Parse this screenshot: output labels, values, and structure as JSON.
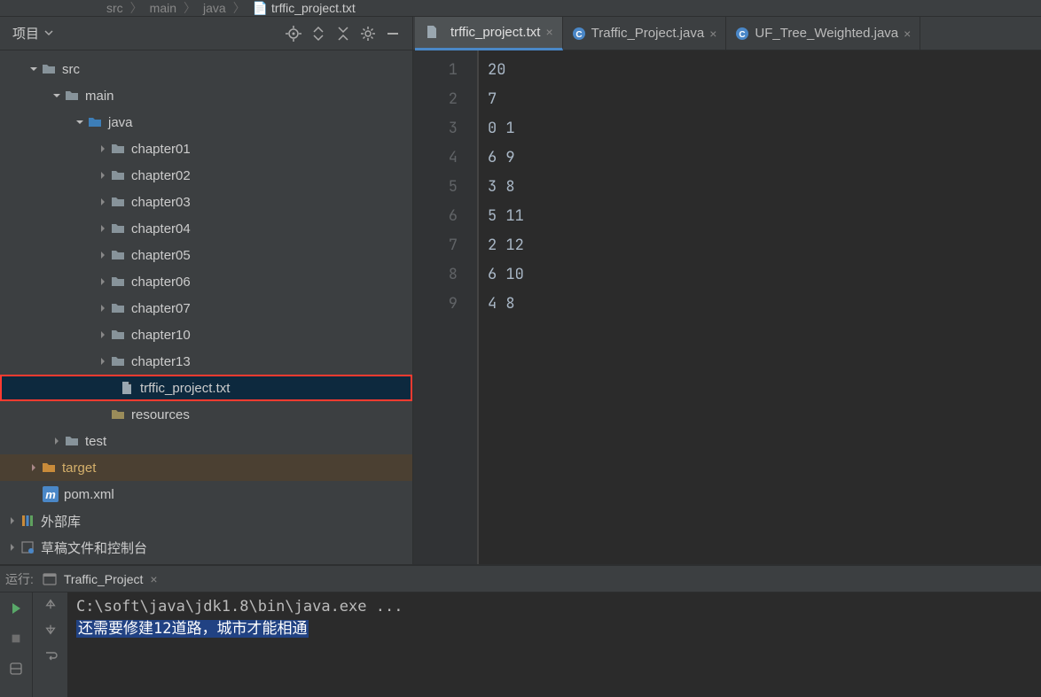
{
  "breadcrumb": {
    "parts": [
      "src",
      "main",
      "java",
      "trffic_project.txt"
    ]
  },
  "sidebar": {
    "title": "项目",
    "tree": {
      "src": "src",
      "main": "main",
      "java": "java",
      "chapters": [
        "chapter01",
        "chapter02",
        "chapter03",
        "chapter04",
        "chapter05",
        "chapter06",
        "chapter07",
        "chapter10",
        "chapter13"
      ],
      "selected_file": "trffic_project.txt",
      "resources": "resources",
      "test": "test",
      "target": "target",
      "pom": "pom.xml",
      "external_libs": "外部库",
      "scratches": "草稿文件和控制台"
    }
  },
  "tabs": [
    {
      "label": "trffic_project.txt",
      "kind": "txt",
      "active": true
    },
    {
      "label": "Traffic_Project.java",
      "kind": "java",
      "active": false
    },
    {
      "label": "UF_Tree_Weighted.java",
      "kind": "java",
      "active": false
    }
  ],
  "editor": {
    "lines": [
      "20",
      "7",
      "0 1",
      "6 9",
      "3 8",
      "5 11",
      "2 12",
      "6 10",
      "4 8"
    ]
  },
  "run": {
    "label": "运行:",
    "config": "Traffic_Project",
    "cmd": "C:\\soft\\java\\jdk1.8\\bin\\java.exe ...",
    "output": "还需要修建12道路，城市才能相通"
  }
}
